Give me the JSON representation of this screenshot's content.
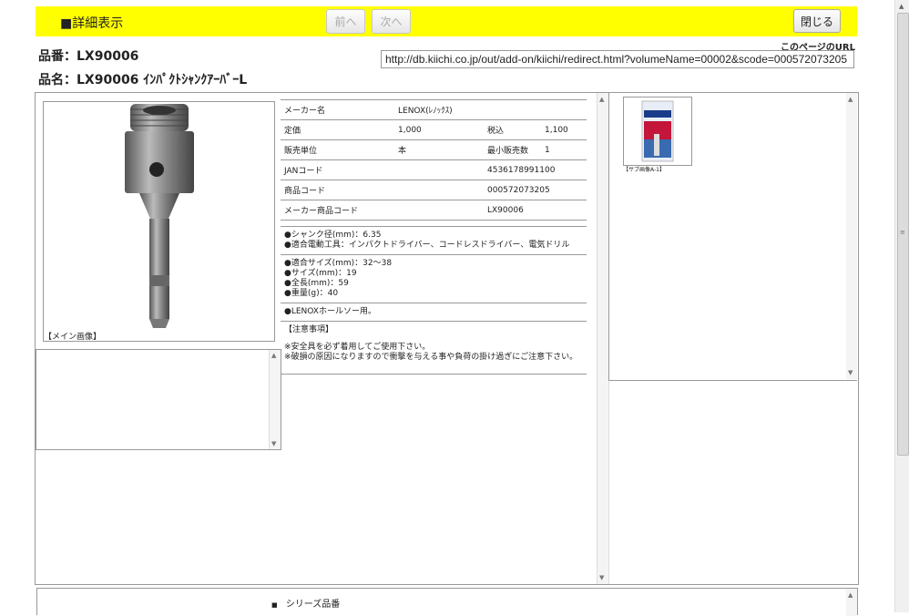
{
  "header": {
    "title": "■詳細表示",
    "prev_label": "前へ",
    "next_label": "次へ",
    "close_label": "閉じる"
  },
  "product": {
    "number_line": "品番：LX90006",
    "name_line": "品名：LX90006 ｲﾝﾊﾟｸﾄｼｬﾝｸｱｰﾊﾞｰL"
  },
  "page_url": {
    "label": "このページのURL",
    "value": "http://db.kiichi.co.jp/out/add-on/kiichi/redirect.html?volumeName=00002&scode=000572073205"
  },
  "images": {
    "main_caption": "【メイン画像】",
    "sub_caption": "【サブ画像A-1】"
  },
  "spec": {
    "maker_label": "メーカー名",
    "maker_value": "LENOX(ﾚﾉｯｸｽ)",
    "list_price_label": "定価",
    "list_price_value": "1,000",
    "tax_in_label": "税込",
    "tax_in_value": "1,100",
    "unit_label": "販売単位",
    "unit_value": "本",
    "min_qty_label": "最小販売数",
    "min_qty_value": "1",
    "jan_label": "JANコード",
    "jan_value": "4536178991100",
    "code_label": "商品コード",
    "code_value": "000572073205",
    "maker_code_label": "メーカー商品コード",
    "maker_code_value": "LX90006"
  },
  "description": {
    "block1": "●シャンク径(mm)：6.35\n●適合電動工具：インパクトドライバー、コードレスドライバー、電気ドリル",
    "block2": "●適合サイズ(mm)：32～38\n●サイズ(mm)：19\n●全長(mm)：59\n●重量(g)：40",
    "block3": "●LENOXホールソー用。",
    "block4_title": "【注意事項】",
    "block4_body": "※安全具を必ず着用してご使用下さい。\n※破損の原因になりますので衝撃を与える事や負荷の掛け過ぎにご注意下さい。"
  },
  "series": {
    "label": "シリーズ品番"
  },
  "colors": {
    "header_bg": "#ffff00",
    "border": "#999999"
  }
}
